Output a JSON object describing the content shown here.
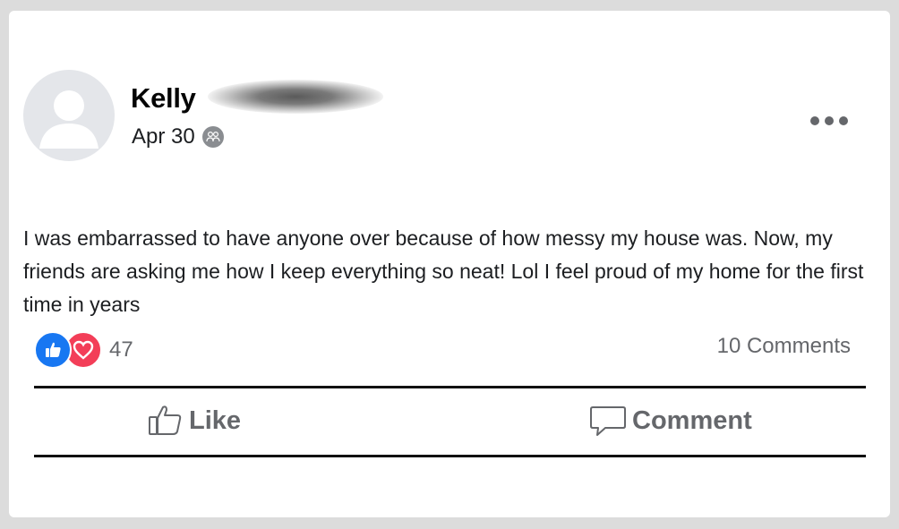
{
  "post": {
    "author": {
      "first_name": "Kelly"
    },
    "date": "Apr 30",
    "privacy": "friends-icon",
    "body": "I was embarrassed to have anyone over because of how messy my house was. Now, my friends are asking me how I keep everything so neat! Lol I feel proud of my home for the first time in years",
    "reactions": {
      "types": [
        "like-reaction-icon",
        "love-reaction-icon"
      ],
      "count": "47"
    },
    "comments_count": "10 Comments"
  },
  "actions": {
    "like_label": "Like",
    "comment_label": "Comment"
  },
  "colors": {
    "like_blue": "#1877f2",
    "love_red": "#f33e58",
    "secondary_text": "#65676b"
  }
}
